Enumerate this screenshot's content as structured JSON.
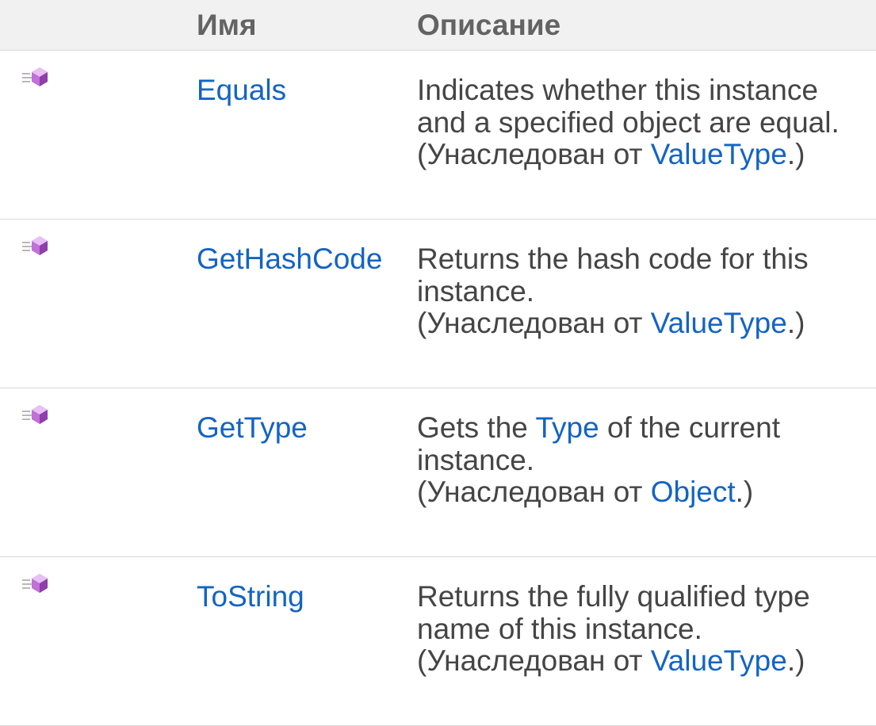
{
  "table": {
    "header": {
      "name": "Имя",
      "description": "Описание"
    },
    "rows": [
      {
        "icon": "public-method-icon",
        "name": "Equals",
        "description": "Indicates whether this instance and a specified object are equal.",
        "inherited_prefix": "(Унаследован от ",
        "inherited_type": "ValueType",
        "inherited_suffix": ".)"
      },
      {
        "icon": "public-method-icon",
        "name": "GetHashCode",
        "description": "Returns the hash code for this instance.",
        "inherited_prefix": "(Унаследован от ",
        "inherited_type": "ValueType",
        "inherited_suffix": ".)"
      },
      {
        "icon": "public-method-icon",
        "name": "GetType",
        "description_before": "Gets the ",
        "description_link": "Type",
        "description_after": " of the current instance.",
        "inherited_prefix": "(Унаследован от ",
        "inherited_type": "Object",
        "inherited_suffix": ".)"
      },
      {
        "icon": "public-method-icon",
        "name": "ToString",
        "description": "Returns the fully qualified type name of this instance.",
        "inherited_prefix": "(Унаследован от ",
        "inherited_type": "ValueType",
        "inherited_suffix": ".)"
      }
    ]
  },
  "colors": {
    "link": "#1364c4",
    "header_bg": "#f1f1f1",
    "text": "#454545",
    "divider": "#d8d8d8"
  }
}
